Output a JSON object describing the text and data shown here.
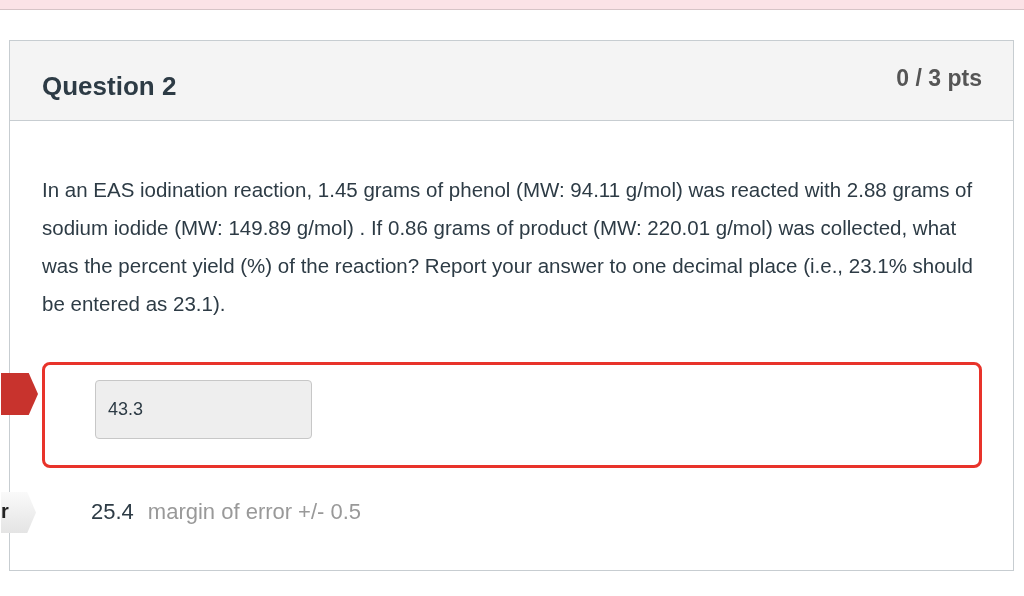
{
  "question": {
    "title": "Question 2",
    "points": "0 / 3 pts",
    "text": "In an EAS iodination reaction, 1.45 grams of phenol (MW: 94.11 g/mol) was reacted with 2.88 grams of sodium iodide (MW: 149.89 g/mol) . If 0.86 grams of product (MW: 220.01 g/mol) was collected, what was the percent yield (%) of the reaction? Report your answer to one decimal place (i.e., 23.1% should be entered as 23.1).",
    "answer": {
      "value": "43.3",
      "correct": false
    },
    "correct_answer": {
      "tab_label": "r",
      "value": "25.4",
      "margin_label": "margin of error",
      "margin_value": "+/- 0.5"
    }
  }
}
